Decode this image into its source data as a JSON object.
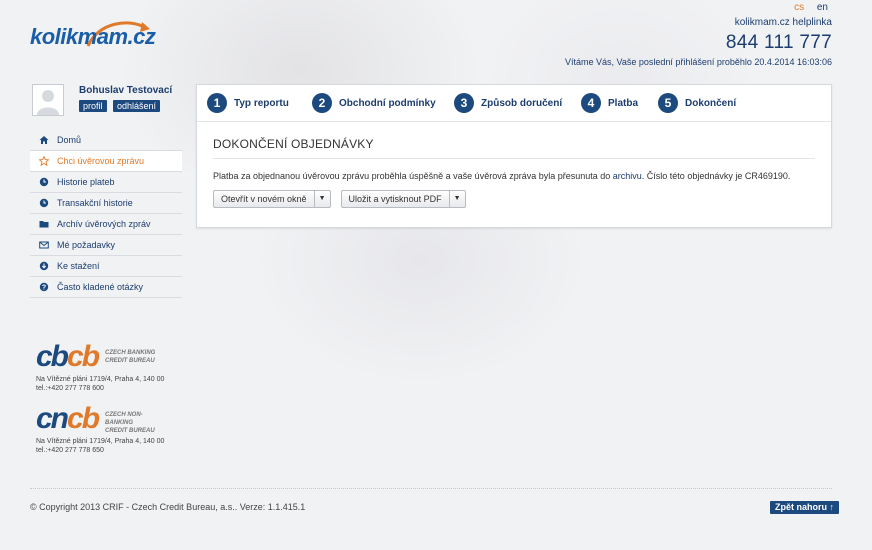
{
  "header": {
    "logo_part1": "kolik",
    "logo_part2": "mam.cz",
    "langs": [
      "cs",
      "en"
    ],
    "helpline_label": "kolikmam.cz helplinka",
    "phone": "844 111 777",
    "welcome": "Vítáme Vás, Vaše poslední přihlášení proběhlo 20.4.2014 16:03:06"
  },
  "user": {
    "name": "Bohuslav Testovací",
    "profile_label": "profil",
    "logout_label": "odhlášení"
  },
  "sidebar": {
    "items": [
      {
        "label": "Domů",
        "icon": "home-icon"
      },
      {
        "label": "Chci úvěrovou zprávu",
        "icon": "star-icon"
      },
      {
        "label": "Historie plateb",
        "icon": "clock-icon"
      },
      {
        "label": "Transakční historie",
        "icon": "clock-icon"
      },
      {
        "label": "Archív úvěrových zpráv",
        "icon": "folder-icon"
      },
      {
        "label": "Mé požadavky",
        "icon": "envelope-icon"
      },
      {
        "label": "Ke stažení",
        "icon": "download-icon"
      },
      {
        "label": "Často kladené otázky",
        "icon": "question-icon"
      }
    ],
    "active_index": 1
  },
  "bureaus": [
    {
      "mark1": "cb",
      "mark2": "cb",
      "tag1": "CZECH BANKING",
      "tag2": "CREDIT BUREAU",
      "addr1": "Na Vítězné pláni 1719/4, Praha 4, 140 00",
      "addr2": "tel.:+420 277 778 600"
    },
    {
      "mark1": "cn",
      "mark2": "cb",
      "tag1": "CZECH NON-BANKING",
      "tag2": "CREDIT BUREAU",
      "addr1": "Na Vítězné pláni 1719/4, Praha 4, 140 00",
      "addr2": "tel.:+420 277 778 650"
    }
  ],
  "steps": [
    {
      "num": "1",
      "label": "Typ reportu"
    },
    {
      "num": "2",
      "label": "Obchodní podmínky"
    },
    {
      "num": "3",
      "label": "Způsob doručení"
    },
    {
      "num": "4",
      "label": "Platba"
    },
    {
      "num": "5",
      "label": "Dokončení"
    }
  ],
  "main": {
    "title": "DOKONČENÍ OBJEDNÁVKY",
    "message_before": "Platba za objednanou úvěrovou zprávu proběhla úspěšně a vaše úvěrová zpráva byla přesunuta do ",
    "message_link": "archivu",
    "message_after": ". Číslo této objednávky je CR469190.",
    "btn_open": "Otevřít v novém okně",
    "btn_save": "Uložit a vytisknout PDF"
  },
  "footer": {
    "copyright": "© Copyright 2013 CRIF - Czech Credit Bureau, a.s.. Verze: 1.1.415.1",
    "top_button": "Zpět nahoru ↑"
  },
  "colors": {
    "brand_blue": "#1d4a7e",
    "accent_orange": "#e07a2a"
  }
}
